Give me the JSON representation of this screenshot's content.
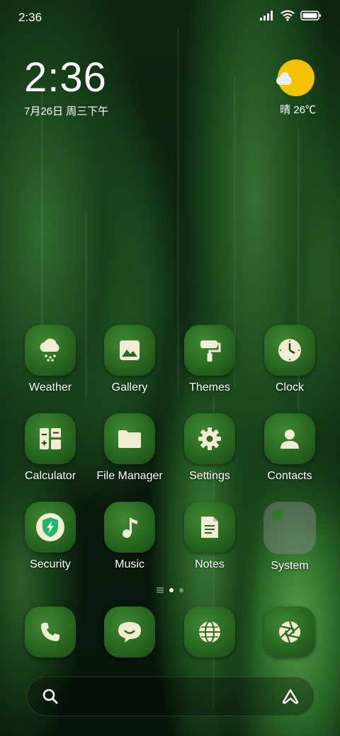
{
  "status_bar": {
    "time": "2:36"
  },
  "clock_widget": {
    "time": "2:36",
    "date": "7月26日 周三下午"
  },
  "weather_widget": {
    "condition": "晴",
    "temperature": "26℃"
  },
  "apps": [
    {
      "label": "Weather",
      "icon": "weather-icon"
    },
    {
      "label": "Gallery",
      "icon": "gallery-icon"
    },
    {
      "label": "Themes",
      "icon": "themes-icon"
    },
    {
      "label": "Clock",
      "icon": "clock-icon"
    },
    {
      "label": "Calculator",
      "icon": "calculator-icon"
    },
    {
      "label": "File Manager",
      "icon": "file-manager-icon"
    },
    {
      "label": "Settings",
      "icon": "settings-icon"
    },
    {
      "label": "Contacts",
      "icon": "contacts-icon"
    },
    {
      "label": "Security",
      "icon": "security-icon"
    },
    {
      "label": "Music",
      "icon": "music-icon"
    },
    {
      "label": "Notes",
      "icon": "notes-icon"
    },
    {
      "label": "System",
      "icon": "folder-icon"
    }
  ],
  "dock": [
    {
      "icon": "phone-icon"
    },
    {
      "icon": "messages-icon"
    },
    {
      "icon": "browser-icon"
    },
    {
      "icon": "camera-icon"
    }
  ],
  "colors": {
    "icon_green": "#2a6a22",
    "glyph": "#f1ecd2",
    "sun": "#f2c200",
    "security": "#1fb56f"
  }
}
